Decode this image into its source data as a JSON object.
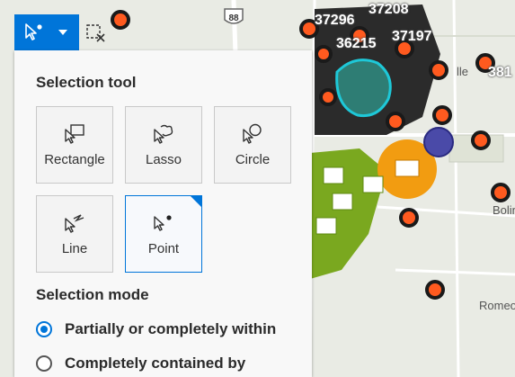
{
  "map": {
    "parcel_labels": [
      "37296",
      "37208",
      "36215",
      "37197",
      "381"
    ],
    "town_labels": [
      "lle",
      "Bolin",
      "Romeo"
    ],
    "road_shield": "88",
    "colors": {
      "marker": "#ff5a1f",
      "selected_parcel": "#1ec8d8",
      "green_cluster": "#7aa81f",
      "orange_cluster": "#f29c11",
      "purple_point": "#4a4aa8"
    }
  },
  "toolbar": {
    "select_tool_icon": "point-select-icon",
    "dropdown_icon": "chevron-down-icon",
    "clear_icon": "clear-selection-icon"
  },
  "panel": {
    "selection_tool_title": "Selection tool",
    "tools": [
      {
        "label": "Rectangle",
        "icon": "rectangle-select-icon"
      },
      {
        "label": "Lasso",
        "icon": "lasso-select-icon"
      },
      {
        "label": "Circle",
        "icon": "circle-select-icon"
      },
      {
        "label": "Line",
        "icon": "line-select-icon"
      },
      {
        "label": "Point",
        "icon": "point-select-icon",
        "selected": true
      }
    ],
    "selection_mode_title": "Selection mode",
    "modes": [
      {
        "label": "Partially or completely within",
        "checked": true
      },
      {
        "label": "Completely contained by",
        "checked": false
      }
    ]
  }
}
